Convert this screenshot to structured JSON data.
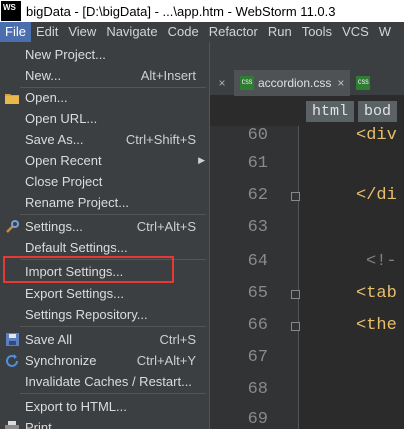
{
  "window": {
    "app_icon_text": "WS",
    "title": "bigData - [D:\\bigData] - ...\\app.htm - WebStorm 11.0.3"
  },
  "menubar": [
    {
      "label": "File",
      "active": true
    },
    {
      "label": "Edit"
    },
    {
      "label": "View"
    },
    {
      "label": "Navigate"
    },
    {
      "label": "Code"
    },
    {
      "label": "Refactor"
    },
    {
      "label": "Run"
    },
    {
      "label": "Tools"
    },
    {
      "label": "VCS"
    },
    {
      "label": "W"
    }
  ],
  "file_menu": {
    "items": [
      {
        "label": "New Project...",
        "shortcut": ""
      },
      {
        "label": "New...",
        "shortcut": "Alt+Insert"
      },
      {
        "label": "Open...",
        "shortcut": "",
        "icon": "folder-icon"
      },
      {
        "label": "Open URL...",
        "shortcut": ""
      },
      {
        "label": "Save As...",
        "shortcut": "Ctrl+Shift+S"
      },
      {
        "label": "Open Recent",
        "shortcut": "",
        "submenu": true
      },
      {
        "label": "Close Project",
        "shortcut": ""
      },
      {
        "label": "Rename Project...",
        "shortcut": ""
      },
      {
        "label": "Settings...",
        "shortcut": "Ctrl+Alt+S",
        "icon": "wrench-icon"
      },
      {
        "label": "Default Settings...",
        "shortcut": ""
      },
      {
        "label": "Import Settings...",
        "shortcut": "",
        "highlighted": true
      },
      {
        "label": "Export Settings...",
        "shortcut": ""
      },
      {
        "label": "Settings Repository...",
        "shortcut": ""
      },
      {
        "label": "Save All",
        "shortcut": "Ctrl+S",
        "icon": "save-icon"
      },
      {
        "label": "Synchronize",
        "shortcut": "Ctrl+Alt+Y",
        "icon": "sync-icon"
      },
      {
        "label": "Invalidate Caches / Restart...",
        "shortcut": ""
      },
      {
        "label": "Export to HTML...",
        "shortcut": ""
      },
      {
        "label": "Print...",
        "shortcut": "",
        "icon": "print-icon"
      }
    ]
  },
  "editor": {
    "tabs": [
      {
        "label": "",
        "close": "×"
      },
      {
        "label": "accordion.css",
        "icon_text": "CSS",
        "close": "×"
      },
      {
        "label": "",
        "icon_text": "CSS"
      }
    ],
    "breadcrumbs": [
      "html",
      "bod"
    ],
    "lines": [
      {
        "num": "60",
        "code": "<div"
      },
      {
        "num": "61",
        "code": ""
      },
      {
        "num": "62",
        "code": "</di"
      },
      {
        "num": "63",
        "code": ""
      },
      {
        "num": "64",
        "code": "<!-"
      },
      {
        "num": "65",
        "code": "<tab"
      },
      {
        "num": "66",
        "code": "<the"
      },
      {
        "num": "67",
        "code": ""
      },
      {
        "num": "68",
        "code": ""
      },
      {
        "num": "69",
        "code": ""
      }
    ]
  },
  "colors": {
    "menu_bg": "#3c3f41",
    "active_menu": "#4b6eaf",
    "editor_bg": "#2b2b2b",
    "highlight_border": "#e53935",
    "tag_color": "#e8bf6a"
  }
}
